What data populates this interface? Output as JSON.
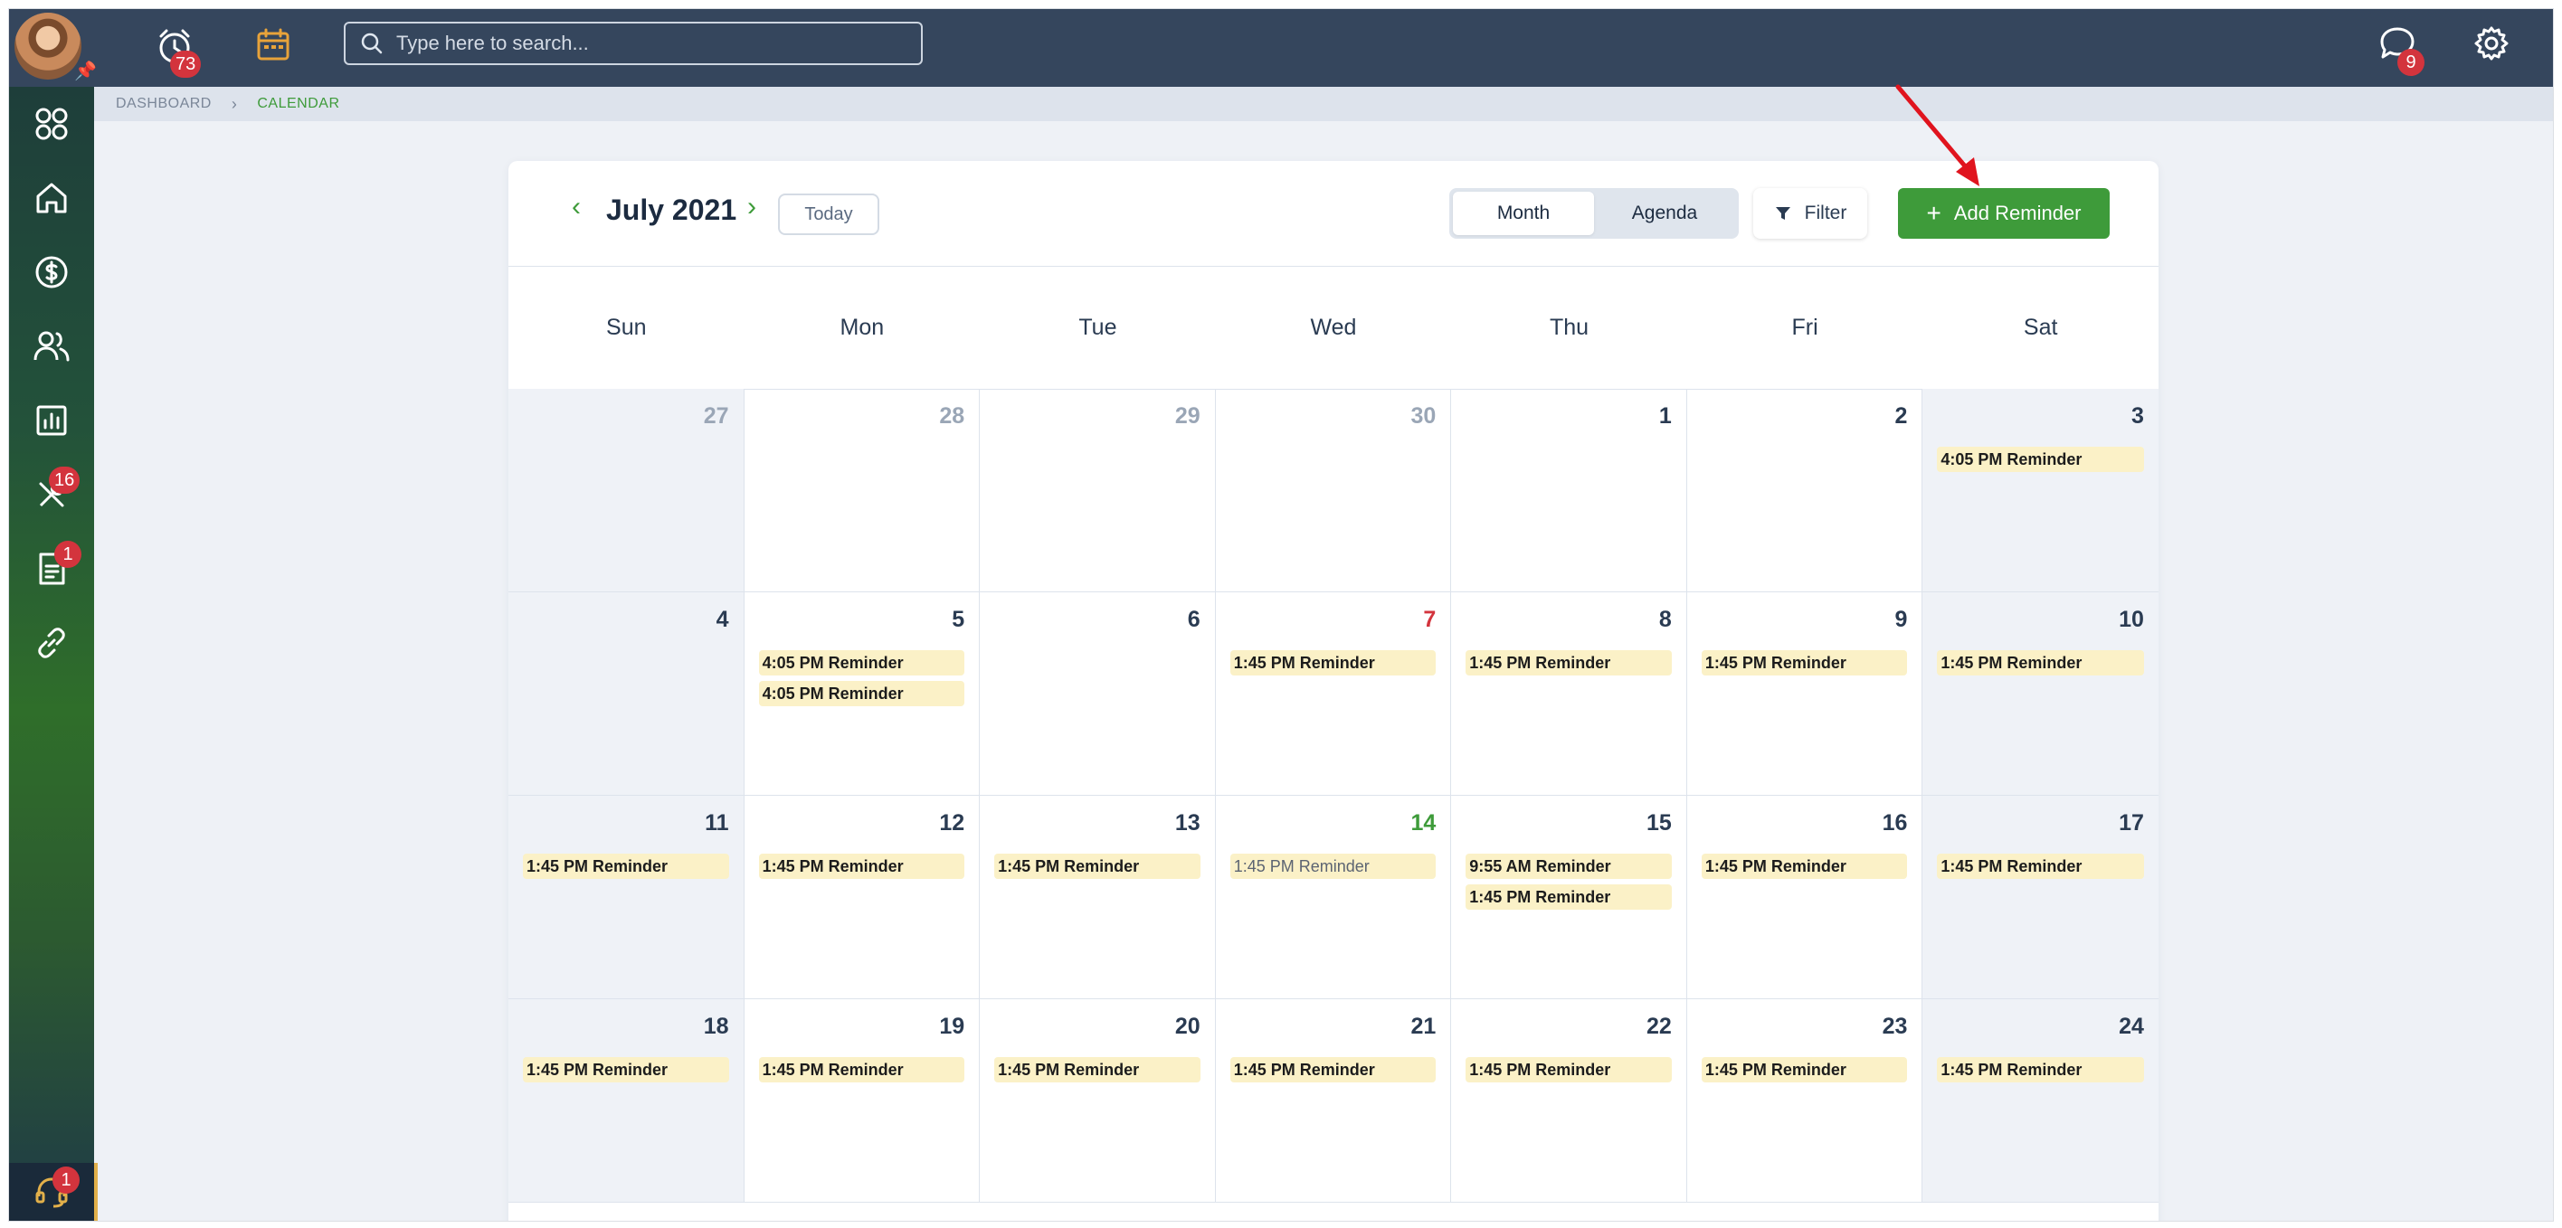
{
  "topbar": {
    "alerts_badge": "73",
    "search_placeholder": "Type here to search...",
    "chat_badge": "9"
  },
  "sidebar": {
    "tools_badge": "16",
    "docs_badge": "1",
    "support_badge": "1"
  },
  "breadcrumb": {
    "root": "DASHBOARD",
    "current": "CALENDAR"
  },
  "calendar": {
    "month_label": "July 2021",
    "today_label": "Today",
    "views": [
      "Month",
      "Agenda"
    ],
    "active_view": "Month",
    "filter_label": "Filter",
    "add_label": "Add Reminder",
    "weekdays": [
      "Sun",
      "Mon",
      "Tue",
      "Wed",
      "Thu",
      "Fri",
      "Sat"
    ],
    "weeks": [
      [
        {
          "day": "27",
          "other": true,
          "events": []
        },
        {
          "day": "28",
          "other": true,
          "events": []
        },
        {
          "day": "29",
          "other": true,
          "events": []
        },
        {
          "day": "30",
          "other": true,
          "events": []
        },
        {
          "day": "1",
          "events": []
        },
        {
          "day": "2",
          "events": []
        },
        {
          "day": "3",
          "events": [
            "4:05 PM Reminder"
          ]
        }
      ],
      [
        {
          "day": "4",
          "events": []
        },
        {
          "day": "5",
          "events": [
            "4:05 PM Reminder",
            "4:05 PM Reminder"
          ]
        },
        {
          "day": "6",
          "events": []
        },
        {
          "day": "7",
          "highlight": "red",
          "events": [
            "1:45 PM Reminder"
          ]
        },
        {
          "day": "8",
          "events": [
            "1:45 PM Reminder"
          ]
        },
        {
          "day": "9",
          "events": [
            "1:45 PM Reminder"
          ]
        },
        {
          "day": "10",
          "events": [
            "1:45 PM Reminder"
          ]
        }
      ],
      [
        {
          "day": "11",
          "events": [
            "1:45 PM Reminder"
          ]
        },
        {
          "day": "12",
          "events": [
            "1:45 PM Reminder"
          ]
        },
        {
          "day": "13",
          "events": [
            "1:45 PM Reminder"
          ]
        },
        {
          "day": "14",
          "highlight": "green",
          "muted": true,
          "events": [
            "1:45 PM Reminder"
          ]
        },
        {
          "day": "15",
          "events": [
            "9:55 AM Reminder",
            "1:45 PM Reminder"
          ]
        },
        {
          "day": "16",
          "events": [
            "1:45 PM Reminder"
          ]
        },
        {
          "day": "17",
          "events": [
            "1:45 PM Reminder"
          ]
        }
      ],
      [
        {
          "day": "18",
          "events": [
            "1:45 PM Reminder"
          ]
        },
        {
          "day": "19",
          "events": [
            "1:45 PM Reminder"
          ]
        },
        {
          "day": "20",
          "events": [
            "1:45 PM Reminder"
          ]
        },
        {
          "day": "21",
          "events": [
            "1:45 PM Reminder"
          ]
        },
        {
          "day": "22",
          "events": [
            "1:45 PM Reminder"
          ]
        },
        {
          "day": "23",
          "events": [
            "1:45 PM Reminder"
          ]
        },
        {
          "day": "24",
          "events": [
            "1:45 PM Reminder"
          ]
        }
      ]
    ]
  },
  "colors": {
    "topbar": "#35465d",
    "accent_green": "#3e9b3a",
    "event_bg": "#fbf1c7",
    "badge_red": "#d3343d",
    "calendar_icon": "#e8a33a"
  },
  "icons": {
    "alarm": "alarm-clock-icon",
    "calendar": "calendar-icon",
    "search": "search-icon",
    "chat": "chat-bubble-icon",
    "settings": "gear-icon"
  }
}
